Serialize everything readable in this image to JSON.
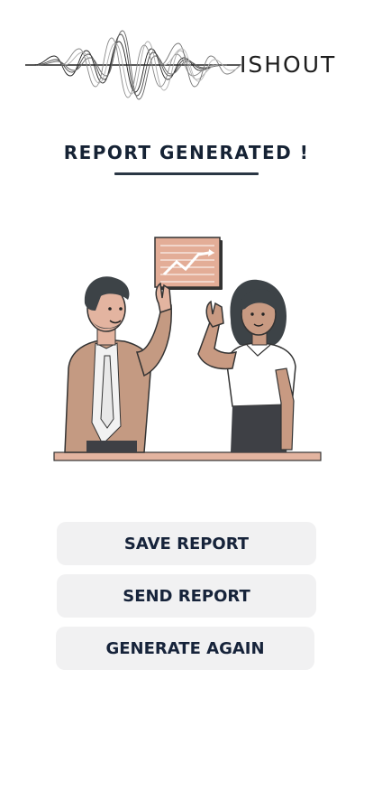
{
  "app": {
    "brand_name": "ISHOUT"
  },
  "page": {
    "title": "REPORT GENERATED !"
  },
  "illustration": {
    "description_icon": "two-people-high-five-with-growth-chart-icon"
  },
  "actions": {
    "save_label": "SAVE REPORT",
    "send_label": "SEND REPORT",
    "generate_label": "GENERATE AGAIN"
  },
  "colors": {
    "title_text": "#152234",
    "button_bg": "#f1f1f2",
    "button_text": "#16233a",
    "accent_skin": "#c89a82",
    "desk": "#e3b4a0"
  }
}
